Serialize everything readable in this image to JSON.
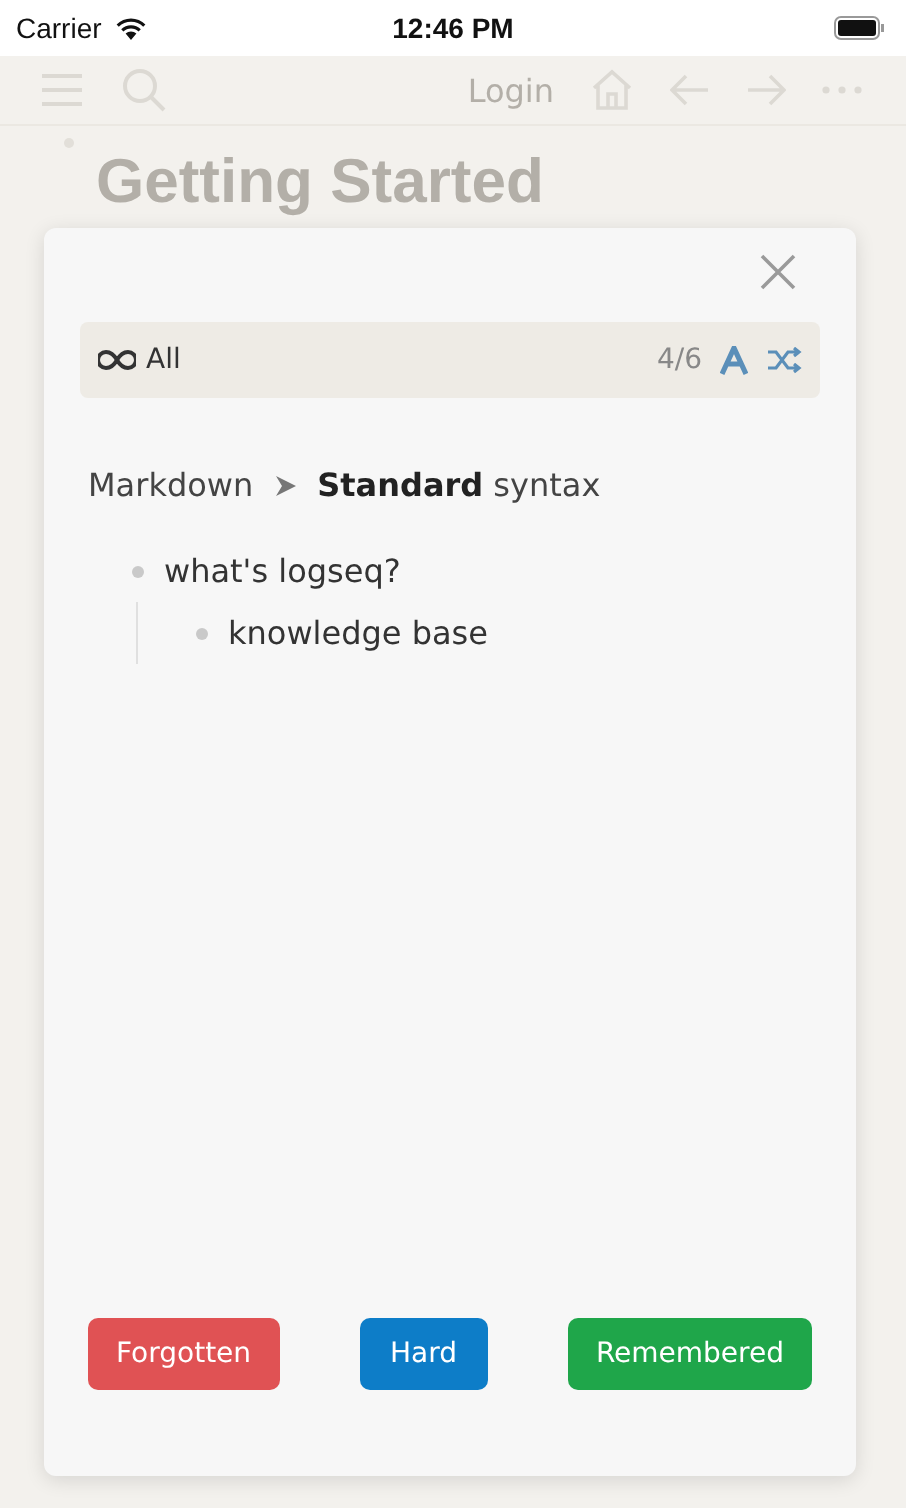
{
  "status_bar": {
    "carrier": "Carrier",
    "time": "12:46 PM"
  },
  "toolbar": {
    "login": "Login"
  },
  "page": {
    "title": "Getting Started"
  },
  "card_dialog": {
    "filter": {
      "label": "All"
    },
    "counter": "4/6",
    "breadcrumb": [
      {
        "text": "Markdown"
      },
      {
        "text": "**Standard** syntax"
      }
    ],
    "blocks": [
      {
        "text": "what's logseq?",
        "children": [
          {
            "text": "knowledge base"
          }
        ]
      }
    ],
    "buttons": [
      {
        "label": "Forgotten",
        "kind": "forgotten"
      },
      {
        "label": "Hard",
        "kind": "hard"
      },
      {
        "label": "Remembered",
        "kind": "remembered"
      }
    ]
  }
}
